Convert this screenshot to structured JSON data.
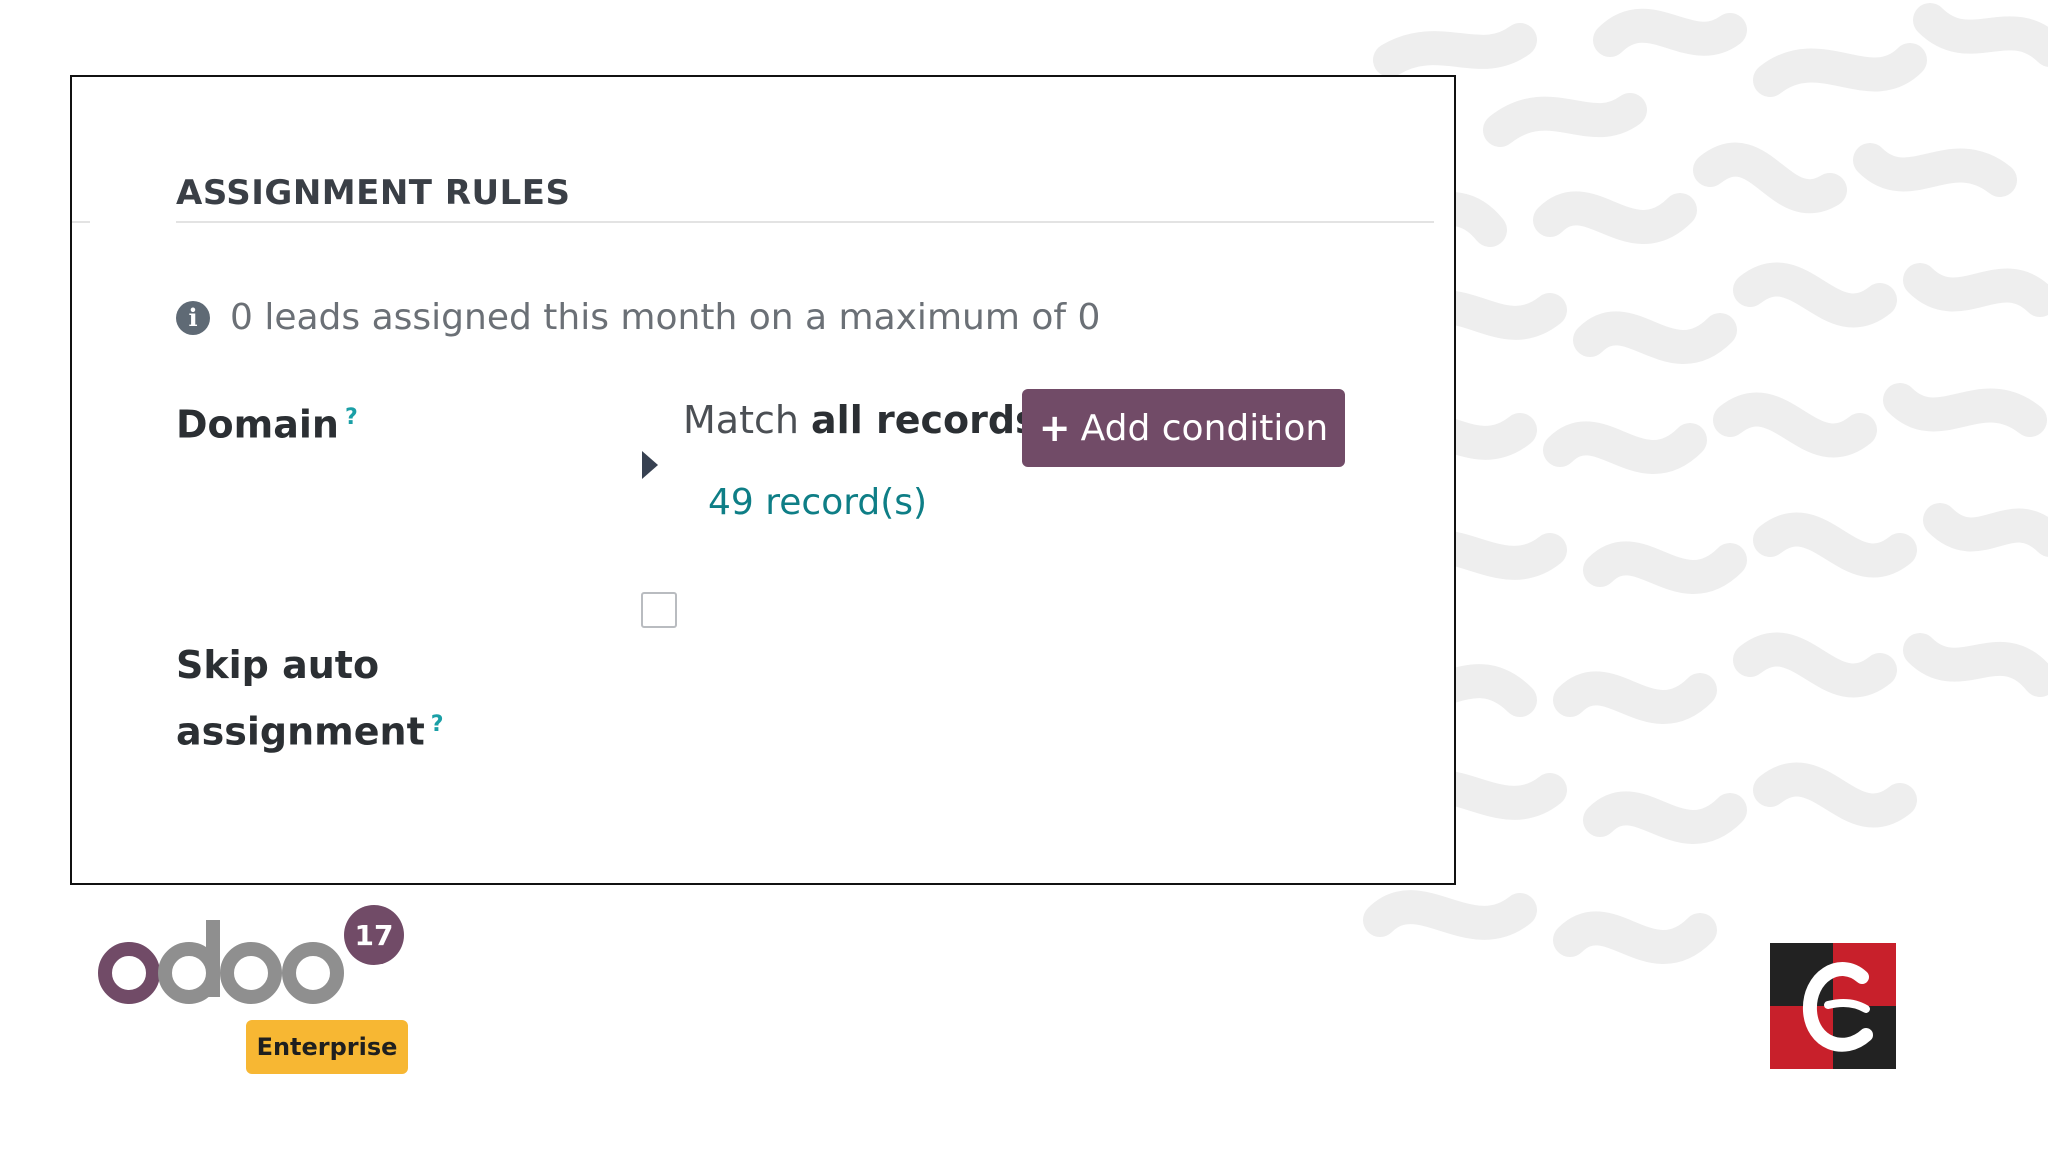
{
  "section": {
    "title": "ASSIGNMENT RULES"
  },
  "info": {
    "icon": "info-circle-icon",
    "text": "0 leads assigned this month on a maximum of 0"
  },
  "domain": {
    "label": "Domain",
    "help": "?",
    "match_prefix": "Match ",
    "match_strong": "all records",
    "add_button_label": "Add condition",
    "records_link": "49 record(s)"
  },
  "skip_auto": {
    "label_line1": "Skip auto",
    "label_line2": "assignment",
    "help": "?",
    "checked": false
  },
  "branding": {
    "version_badge": "17",
    "edition_badge": "Enterprise"
  },
  "colors": {
    "primary": "#714b67",
    "link": "#0e7e86",
    "enterprise": "#f7b733",
    "logo_gray": "#8f8f8f"
  }
}
